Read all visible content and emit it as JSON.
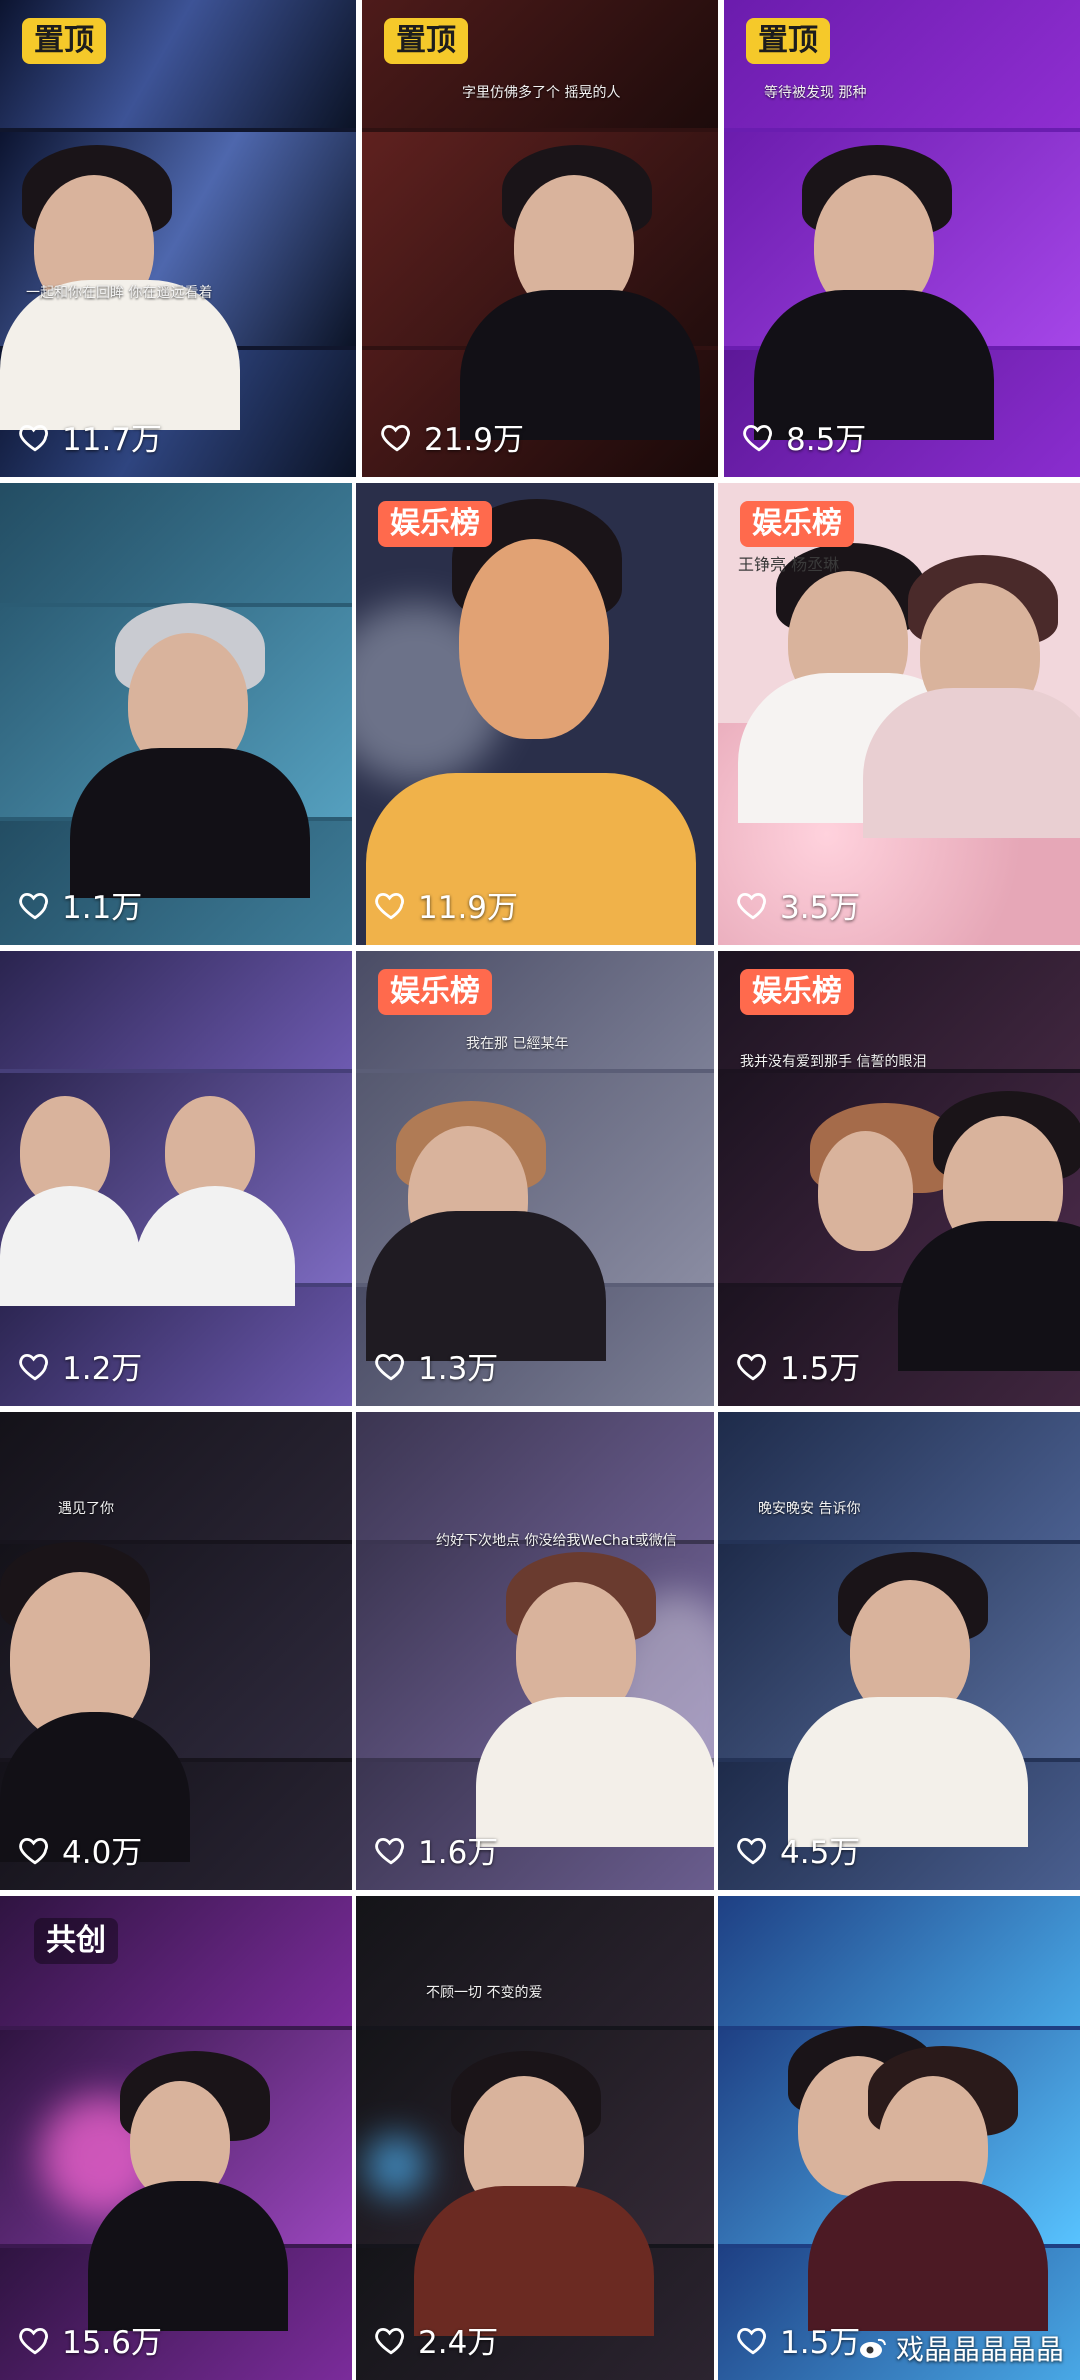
{
  "feed": [
    {
      "badge": "置顶",
      "badge_type": "pin",
      "likes": "11.7万",
      "subtitle": "一起和你在回眸 你在遥远看着",
      "bg": "#1a2542",
      "accent": "#8ea2d6"
    },
    {
      "badge": "置顶",
      "badge_type": "pin",
      "likes": "21.9万",
      "subtitle": "字里仿佛多了个 摇晃的人",
      "bg": "#3b1516",
      "accent": "#9a3a36"
    },
    {
      "badge": "置顶",
      "badge_type": "pin",
      "likes": "8.5万",
      "subtitle": "等待被发现 那种",
      "bg": "#6c1cab",
      "accent": "#b35cf0"
    },
    {
      "badge": "",
      "badge_type": "",
      "likes": "1.1万",
      "subtitle": "",
      "bg": "#2e5f77",
      "accent": "#5aa1bd"
    },
    {
      "badge": "娱乐榜",
      "badge_type": "rank",
      "likes": "11.9万",
      "subtitle": "",
      "bg": "#2a2f4a",
      "accent": "#f0a64a"
    },
    {
      "badge": "娱乐榜",
      "badge_type": "rank",
      "likes": "3.5万",
      "subtitle": "王铮亮 杨丞琳",
      "bg": "#e7b1bf",
      "accent": "#f8e2e8"
    },
    {
      "badge": "",
      "badge_type": "",
      "likes": "1.2万",
      "subtitle": "",
      "bg": "#463f79",
      "accent": "#9c8fd0"
    },
    {
      "badge": "娱乐榜",
      "badge_type": "rank",
      "likes": "1.3万",
      "subtitle": "我在那 已經某年",
      "bg": "#5b5e77",
      "accent": "#b2b5c7"
    },
    {
      "badge": "娱乐榜",
      "badge_type": "rank",
      "likes": "1.5万",
      "subtitle": "我并没有爱到那手 信誓的眼泪",
      "bg": "#1c1320",
      "accent": "#6b4870"
    },
    {
      "badge": "",
      "badge_type": "",
      "likes": "4.0万",
      "subtitle": "遇见了你",
      "bg": "#17141d",
      "accent": "#35b7e0"
    },
    {
      "badge": "",
      "badge_type": "",
      "likes": "1.6万",
      "subtitle": "约好下次地点 你没给我WeChat或微信",
      "bg": "#3b3551",
      "accent": "#f4f0f5"
    },
    {
      "badge": "",
      "badge_type": "",
      "likes": "4.5万",
      "subtitle": "晚安晚安 告诉你",
      "bg": "#243357",
      "accent": "#c7d5ef"
    },
    {
      "badge": "共创",
      "badge_type": "cocreate",
      "likes": "15.6万",
      "subtitle": "",
      "bg": "#3b1950",
      "accent": "#e59be0"
    },
    {
      "badge": "",
      "badge_type": "",
      "likes": "2.4万",
      "subtitle": "不顾一切 不变的爱",
      "bg": "#15151c",
      "accent": "#4aa7e6"
    },
    {
      "badge": "",
      "badge_type": "",
      "likes": "1.5万",
      "subtitle": "",
      "bg": "#1e3f83",
      "accent": "#5ed7ff"
    }
  ],
  "watermark": "戏晶晶晶晶晶",
  "colors": {
    "pin_badge": "#f5c92a",
    "rank_badge": "#ff6a4d",
    "text": "#ffffff"
  }
}
